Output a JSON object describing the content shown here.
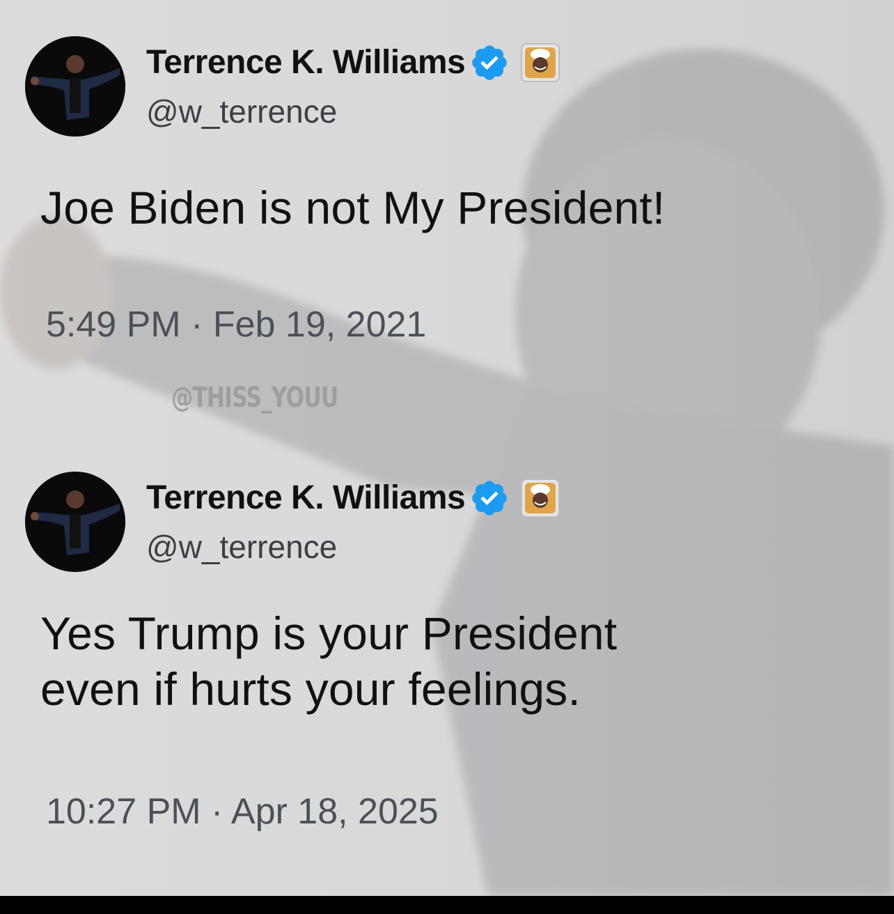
{
  "tweets": [
    {
      "display_name": "Terrence K. Williams",
      "handle": "@w_terrence",
      "text": "Joe Biden is not My President!",
      "timestamp": "5:49 PM · Feb 19, 2021",
      "verified_icon": "verified-badge-icon",
      "affiliate_icon": "chef-emoji-badge-icon",
      "avatar_icon": "profile-photo-avatar"
    },
    {
      "display_name": "Terrence K. Williams",
      "handle": "@w_terrence",
      "text": "Yes Trump is your President\neven if hurts your feelings.",
      "timestamp": "10:27 PM · Apr 18, 2025",
      "verified_icon": "verified-badge-icon",
      "affiliate_icon": "chef-emoji-badge-icon",
      "avatar_icon": "profile-photo-avatar"
    }
  ],
  "watermark": "@THISS_YOUU",
  "colors": {
    "verified_blue": "#1d9bf0",
    "text_primary": "#111111",
    "text_secondary": "#4c5057",
    "background": "#d6d6d6"
  }
}
